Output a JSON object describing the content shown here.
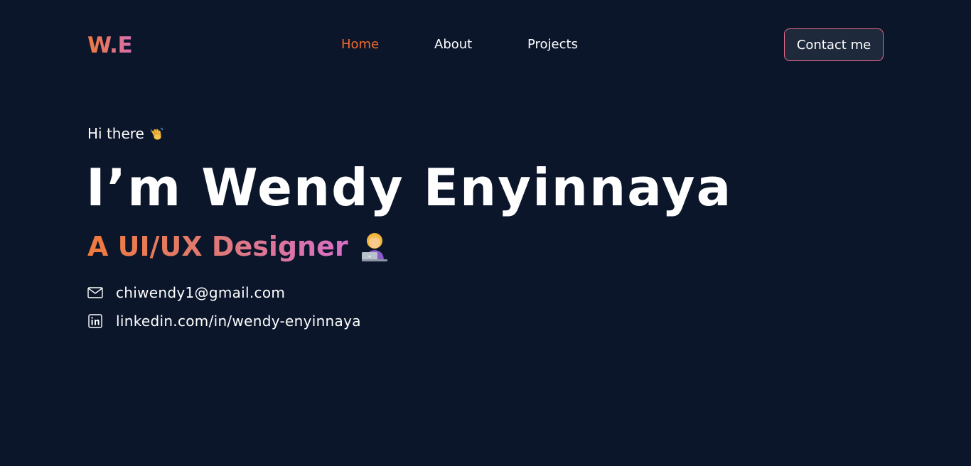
{
  "nav": {
    "logo": "W.E",
    "links": [
      {
        "label": "Home",
        "active": true
      },
      {
        "label": "About",
        "active": false
      },
      {
        "label": "Projects",
        "active": false
      }
    ],
    "cta_label": "Contact me"
  },
  "hero": {
    "greeting": "Hi there",
    "greeting_icon": "waving-hand-icon",
    "name": "I’m Wendy Enyinnaya",
    "role": "A UI/UX Designer",
    "role_icon": "woman-technologist-icon",
    "email": "chiwendy1@gmail.com",
    "email_icon": "mail-icon",
    "linkedin": "linkedin.com/in/wendy-enyinnaya",
    "linkedin_icon": "linkedin-icon"
  },
  "colors": {
    "background": "#0b162b",
    "accent_active": "#f26a2e",
    "gradient_start": "#f07a3c",
    "gradient_end": "#d86fb0",
    "button_bg": "#1e293b",
    "button_border": "#e56a8c"
  }
}
